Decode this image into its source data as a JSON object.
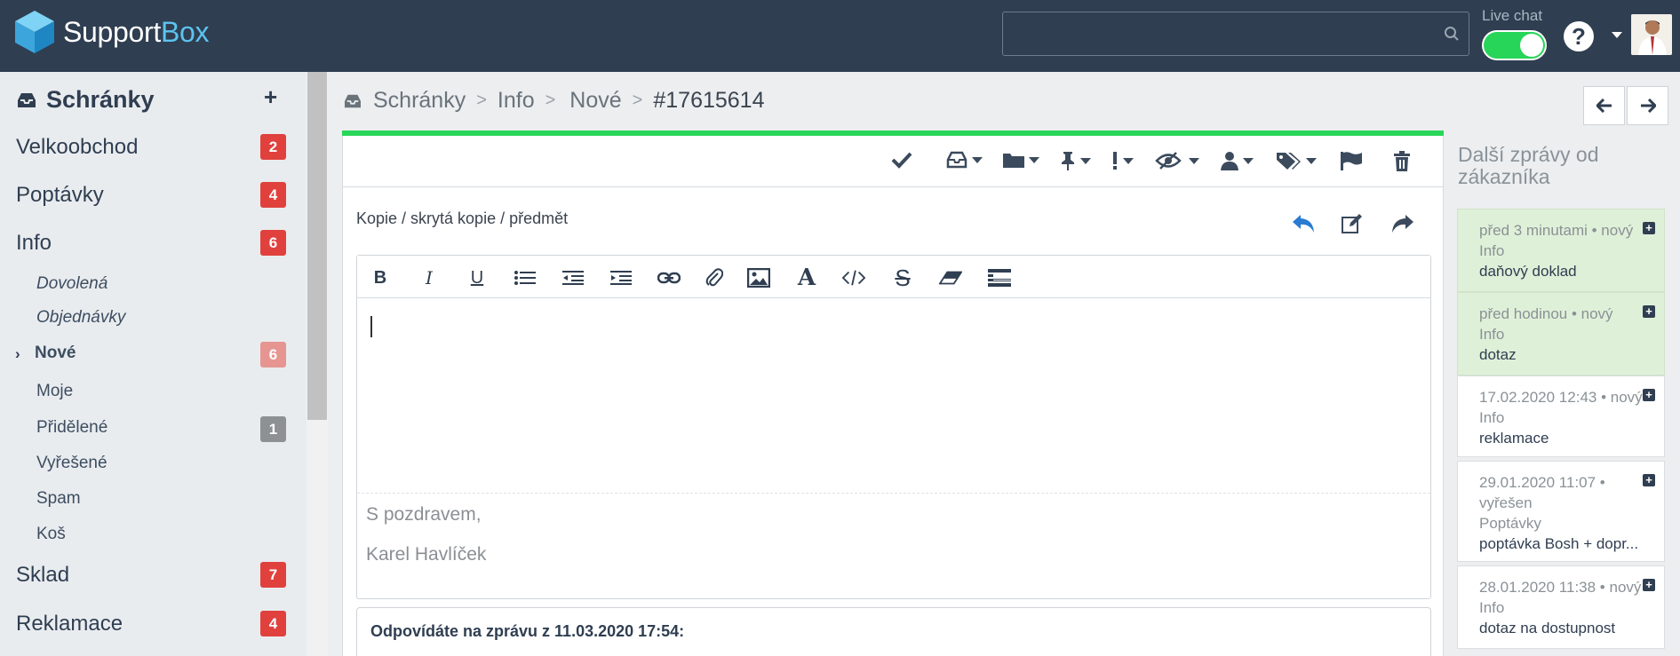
{
  "app": {
    "logo_part1": "Support",
    "logo_part2": "Box",
    "search_placeholder": "",
    "livechat_label": "Live chat",
    "help_label": "?"
  },
  "sidebar": {
    "title": "Schránky",
    "add_label": "+",
    "items": [
      {
        "label": "Velkoobchod",
        "badge": "2"
      },
      {
        "label": "Poptávky",
        "badge": "4"
      },
      {
        "label": "Info",
        "badge": "6"
      },
      {
        "label": "Sklad",
        "badge": "7"
      },
      {
        "label": "Reklamace",
        "badge": "4"
      }
    ],
    "subitems": [
      {
        "label": "Dovolená"
      },
      {
        "label": "Objednávky"
      },
      {
        "label": "Nové",
        "badge": "6"
      },
      {
        "label": "Moje"
      },
      {
        "label": "Přidělené",
        "badge": "1"
      },
      {
        "label": "Vyřešené"
      },
      {
        "label": "Spam"
      },
      {
        "label": "Koš"
      }
    ]
  },
  "breadcrumb": {
    "items": [
      "Schránky",
      "Info",
      "Nové",
      "#17615614"
    ],
    "separator": ">"
  },
  "composer": {
    "cc_label": "Kopie / skrytá kopie / předmět",
    "signature_line1": "S pozdravem,",
    "signature_line2": "Karel Havlíček",
    "reply_to": "Odpovídáte na zprávu z 11.03.2020 17:54:"
  },
  "right_panel": {
    "title": "Další zprávy od zákazníka",
    "messages": [
      {
        "meta": "před 3 minutami • nový",
        "inbox": "Info",
        "subject": "daňový doklad",
        "state": "new"
      },
      {
        "meta": "před hodinou • nový",
        "inbox": "Info",
        "subject": "dotaz",
        "state": "new"
      },
      {
        "meta": "17.02.2020 12:43 • nový",
        "inbox": "Info",
        "subject": "reklamace",
        "state": "old"
      },
      {
        "meta": "29.01.2020 11:07 •",
        "meta2": "vyřešen",
        "inbox": "Poptávky",
        "subject": "poptávka Bosh + dopr...",
        "state": "old"
      },
      {
        "meta": "28.01.2020 11:38 • nový",
        "inbox": "Info",
        "subject": "dotaz na dostupnost",
        "state": "old"
      }
    ]
  },
  "colors": {
    "topbar": "#2f3e51",
    "accent_green": "#27d559",
    "badge_red": "#e0413d",
    "logo_blue": "#5dc3f0"
  }
}
